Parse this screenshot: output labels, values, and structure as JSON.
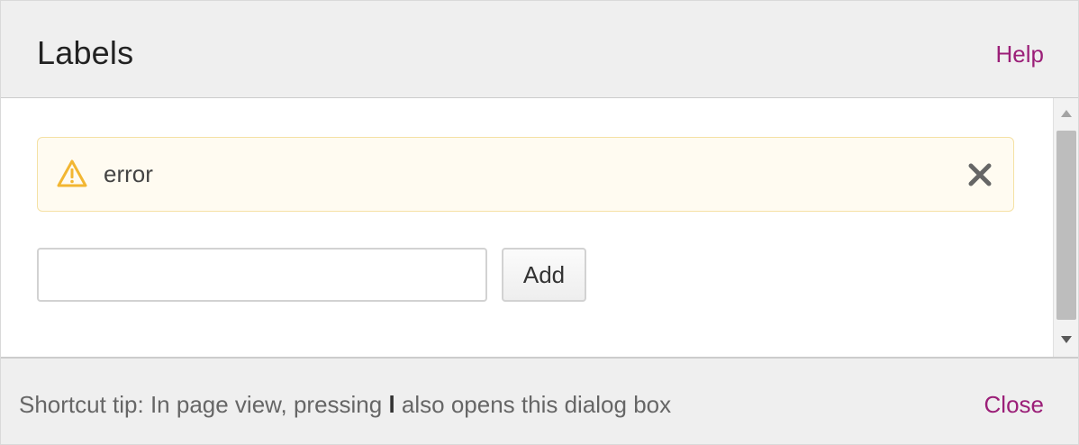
{
  "dialog": {
    "title": "Labels",
    "help_label": "Help",
    "close_label": "Close"
  },
  "alert": {
    "icon": "warning-icon",
    "message": "error",
    "close_icon": "close-icon"
  },
  "form": {
    "label_value": "",
    "add_label": "Add"
  },
  "footer": {
    "tip_prefix": "Shortcut tip: In page view, pressing ",
    "tip_key": "l",
    "tip_suffix": " also opens this dialog box"
  },
  "colors": {
    "header_background": "#efefef",
    "link": "#9b1f78",
    "alert_background": "#fffbf1",
    "alert_border": "#f5e1a4",
    "warning_icon": "#f2b632",
    "scrollbar_thumb": "#bdbdbd"
  }
}
